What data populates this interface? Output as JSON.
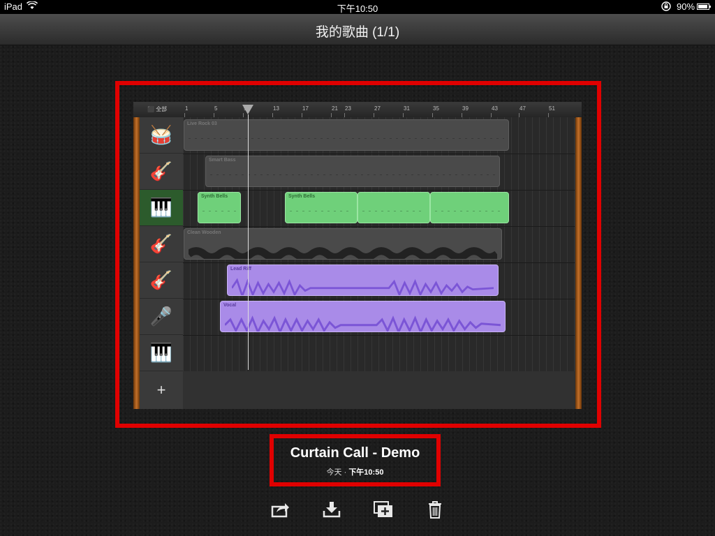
{
  "status_bar": {
    "device": "iPad",
    "time": "下午10:50",
    "battery": "90%",
    "battery_level": 0.9
  },
  "nav": {
    "title": "我的歌曲  (1/1)"
  },
  "song_thumbnail": {
    "ruler": {
      "all_label": "全部",
      "bars": [
        "1",
        "5",
        "9",
        "13",
        "17",
        "21",
        "23",
        "27",
        "31",
        "35",
        "39",
        "43",
        "47",
        "51"
      ]
    },
    "tracks": [
      {
        "instrument": "drum-kit-icon",
        "region_labels": [
          "Live Rock 03"
        ]
      },
      {
        "instrument": "bass-guitar-icon",
        "region_labels": [
          "Smart Bass"
        ]
      },
      {
        "instrument": "keyboard-icon",
        "region_labels": [
          "Synth Bells",
          "Synth Bells"
        ],
        "selected": true
      },
      {
        "instrument": "electric-guitar-icon",
        "region_labels": [
          "Clean Wooden"
        ]
      },
      {
        "instrument": "acoustic-guitar-icon",
        "region_labels": [
          "Lead Riff"
        ]
      },
      {
        "instrument": "microphone-icon",
        "region_labels": [
          "Vocal"
        ]
      },
      {
        "instrument": "organ-icon",
        "region_labels": []
      }
    ],
    "add_track": "+"
  },
  "song": {
    "title": "Curtain Call - Demo",
    "date_prefix": "今天 · ",
    "date_time": "下午10:50"
  },
  "toolbar": {
    "share": "share-icon",
    "download": "download-icon",
    "duplicate": "duplicate-icon",
    "delete": "trash-icon"
  },
  "colors": {
    "highlight_border": "#e00000",
    "green_region": "#6fd07a",
    "purple_region": "#a98be8"
  }
}
